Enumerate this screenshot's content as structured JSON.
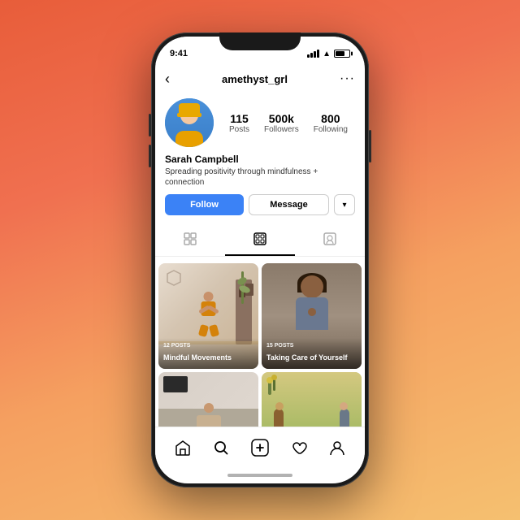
{
  "background": {
    "gradient_start": "#e85d3a",
    "gradient_end": "#f5c070"
  },
  "phone": {
    "status_bar": {
      "time": "9:41",
      "signal": true,
      "wifi": true,
      "battery": true
    },
    "header": {
      "username": "amethyst_grl",
      "back_label": "‹",
      "more_label": "···"
    },
    "profile": {
      "name": "Sarah Campbell",
      "bio": "Spreading positivity through mindfulness + connection",
      "avatar_alt": "Profile photo",
      "stats": {
        "posts": {
          "value": "115",
          "label": "Posts"
        },
        "followers": {
          "value": "500k",
          "label": "Followers"
        },
        "following": {
          "value": "800",
          "label": "Following"
        }
      }
    },
    "buttons": {
      "follow": "Follow",
      "message": "Message",
      "dropdown": "▾"
    },
    "tabs": {
      "grid_label": "Grid",
      "reels_label": "Reels",
      "tagged_label": "Tagged"
    },
    "highlights": [
      {
        "id": "highlight-1",
        "posts": "12 POSTS",
        "title": "Mindful Movements",
        "bg": "yoga"
      },
      {
        "id": "highlight-2",
        "posts": "15 POSTS",
        "title": "Taking Care of Yourself",
        "bg": "woman"
      }
    ],
    "grid_cards": [
      {
        "id": "card-1",
        "bg": "stretch"
      },
      {
        "id": "card-2",
        "bg": "outdoor"
      }
    ],
    "bottom_nav": {
      "home": "⌂",
      "search": "⌕",
      "add": "+",
      "heart": "♡",
      "person": "◯"
    }
  }
}
